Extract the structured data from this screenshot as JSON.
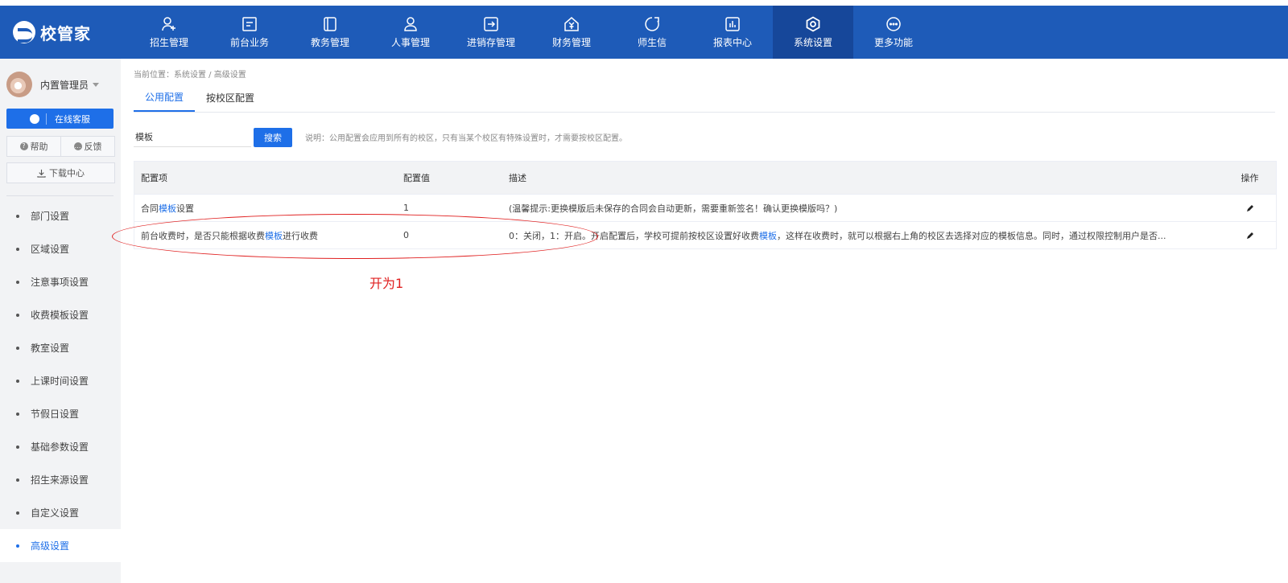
{
  "header": {
    "app_name": "校管家",
    "nav": [
      {
        "label": "招生管理",
        "icon": "add-user-icon"
      },
      {
        "label": "前台业务",
        "icon": "desk-icon"
      },
      {
        "label": "教务管理",
        "icon": "book-icon"
      },
      {
        "label": "人事管理",
        "icon": "person-icon"
      },
      {
        "label": "进销存管理",
        "icon": "arrow-box-icon"
      },
      {
        "label": "财务管理",
        "icon": "yen-house-icon"
      },
      {
        "label": "师生信",
        "icon": "chat-icon"
      },
      {
        "label": "报表中心",
        "icon": "chart-icon"
      },
      {
        "label": "系统设置",
        "icon": "settings-icon",
        "active": true
      },
      {
        "label": "更多功能",
        "icon": "more-icon"
      }
    ]
  },
  "sidebar": {
    "user_name": "内置管理员",
    "service_label": "在线客服",
    "help_label": "帮助",
    "feedback_label": "反馈",
    "download_label": "下载中心",
    "items": [
      {
        "label": "部门设置"
      },
      {
        "label": "区域设置"
      },
      {
        "label": "注意事项设置"
      },
      {
        "label": "收费模板设置"
      },
      {
        "label": "教室设置"
      },
      {
        "label": "上课时间设置"
      },
      {
        "label": "节假日设置"
      },
      {
        "label": "基础参数设置"
      },
      {
        "label": "招生来源设置"
      },
      {
        "label": "自定义设置"
      },
      {
        "label": "高级设置",
        "active": true
      }
    ]
  },
  "main": {
    "breadcrumb": "当前位置：系统设置 / 高级设置",
    "tabs": [
      {
        "label": "公用配置",
        "active": true
      },
      {
        "label": "按校区配置"
      }
    ],
    "search": {
      "value": "模板",
      "button_label": "搜索",
      "hint": "说明：公用配置会应用到所有的校区，只有当某个校区有特殊设置时，才需要按校区配置。"
    },
    "table": {
      "headers": {
        "item": "配置项",
        "value": "配置值",
        "desc": "描述",
        "action": "操作"
      },
      "rows": [
        {
          "item_pre": "合同",
          "item_hl": "模板",
          "item_post": "设置",
          "value": "1",
          "desc_pre": "(温馨提示:更换模版后未保存的合同会自动更新，需要重新签名！确认更换模版吗？)",
          "desc_hl": "",
          "desc_post": ""
        },
        {
          "item_pre": "前台收费时，是否只能根据收费",
          "item_hl": "模板",
          "item_post": "进行收费",
          "value": "0",
          "desc_pre": "0：关闭，1：开启。开启配置后，学校可提前按校区设置好收费",
          "desc_hl": "模板",
          "desc_post": "，这样在收费时，就可以根据右上角的校区去选择对应的模板信息。同时，通过权限控制用户是否..."
        }
      ]
    },
    "annotation": "开为1"
  },
  "colors": {
    "primary": "#1e5bb8",
    "accent": "#1e6fe8",
    "annotation": "#e02020"
  }
}
